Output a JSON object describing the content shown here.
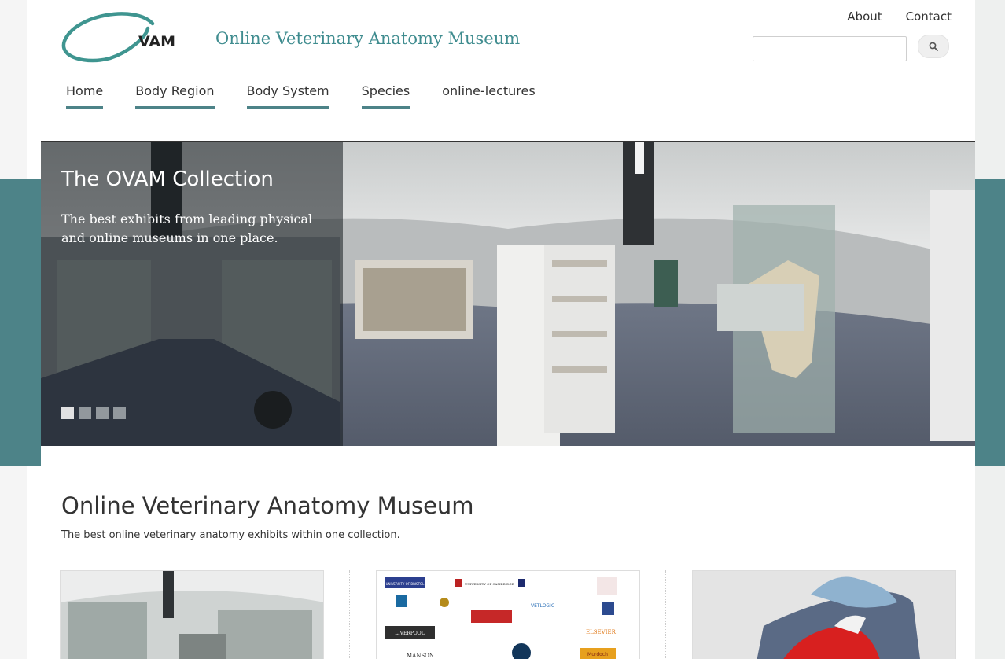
{
  "header": {
    "logo_text": "VAM",
    "site_name": "Online Veterinary Anatomy Museum",
    "top_links": [
      "About",
      "Contact"
    ],
    "search_value": ""
  },
  "nav": {
    "items": [
      "Home",
      "Body Region",
      "Body System",
      "Species",
      "online-lectures"
    ]
  },
  "hero": {
    "title": "The OVAM Collection",
    "text": "The best exhibits from leading physical and online museums in one place.",
    "slide_count": 4,
    "active_slide": 1
  },
  "main": {
    "title": "Online Veterinary Anatomy Museum",
    "subtitle": "The best online veterinary anatomy exhibits within one collection."
  },
  "partners": {
    "names": [
      "UNIVERSITY OF BRISTOL",
      "UNIVERSITY OF CAMBRIDGE",
      "LIVERPOOL",
      "ELSEVIER",
      "MANSON",
      "Murdoch",
      "VETLOGIC"
    ]
  },
  "colors": {
    "accent": "#4d8388",
    "site_name": "#3f8c8f"
  }
}
